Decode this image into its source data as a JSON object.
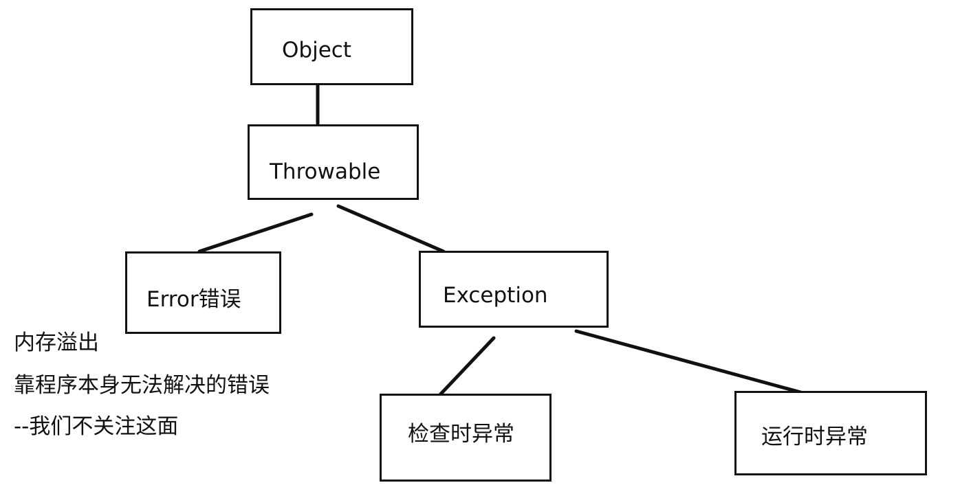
{
  "nodes": {
    "object": "Object",
    "throwable": "Throwable",
    "error": "Error错误",
    "exception": "Exception",
    "checked": "检查时异常",
    "runtime": "运行时异常"
  },
  "notes": [
    "内存溢出",
    "靠程序本身无法解决的错误",
    "--我们不关注这面"
  ]
}
